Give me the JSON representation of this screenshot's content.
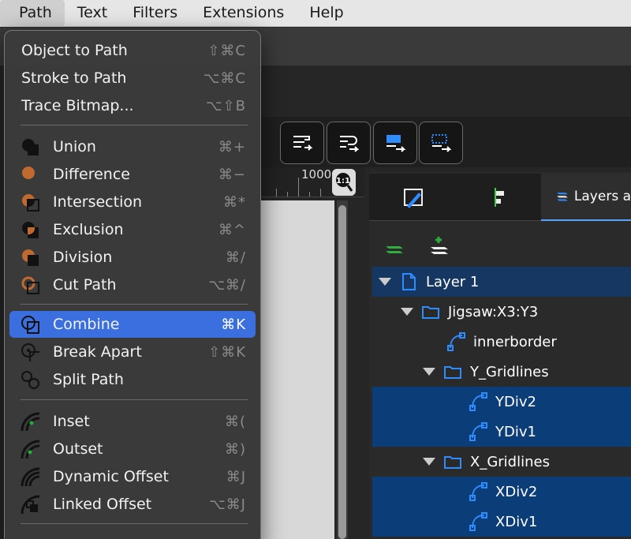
{
  "menubar": {
    "items": [
      {
        "label": "Path",
        "active": true
      },
      {
        "label": "Text",
        "active": false
      },
      {
        "label": "Filters",
        "active": false
      },
      {
        "label": "Extensions",
        "active": false
      },
      {
        "label": "Help",
        "active": false
      }
    ]
  },
  "path_menu": {
    "items": [
      {
        "label": "Object to Path",
        "shortcut": "⇧⌘C",
        "icon": "none"
      },
      {
        "label": "Stroke to Path",
        "shortcut": "⌥⌘C",
        "icon": "none"
      },
      {
        "label": "Trace Bitmap...",
        "shortcut": "⌥⇧B",
        "icon": "none"
      },
      {
        "label": "Union",
        "shortcut": "⌘+",
        "icon": "union-icon"
      },
      {
        "label": "Difference",
        "shortcut": "⌘−",
        "icon": "difference-icon"
      },
      {
        "label": "Intersection",
        "shortcut": "⌘*",
        "icon": "intersection-icon"
      },
      {
        "label": "Exclusion",
        "shortcut": "⌘^",
        "icon": "exclusion-icon"
      },
      {
        "label": "Division",
        "shortcut": "⌘/",
        "icon": "division-icon"
      },
      {
        "label": "Cut Path",
        "shortcut": "⌥⌘/",
        "icon": "cut-path-icon"
      },
      {
        "label": "Combine",
        "shortcut": "⌘K",
        "icon": "combine-icon",
        "highlighted": true
      },
      {
        "label": "Break Apart",
        "shortcut": "⇧⌘K",
        "icon": "break-apart-icon"
      },
      {
        "label": "Split Path",
        "shortcut": "",
        "icon": "split-path-icon"
      },
      {
        "label": "Inset",
        "shortcut": "⌘(",
        "icon": "inset-icon"
      },
      {
        "label": "Outset",
        "shortcut": "⌘)",
        "icon": "outset-icon"
      },
      {
        "label": "Dynamic Offset",
        "shortcut": "⌘J",
        "icon": "dynamic-offset-icon"
      },
      {
        "label": "Linked Offset",
        "shortcut": "⌥⌘J",
        "icon": "linked-offset-icon"
      }
    ]
  },
  "ruler": {
    "label": "1000"
  },
  "zoom": {
    "label": "1:1"
  },
  "dock": {
    "tabs": [
      {
        "label": "",
        "icon": "fill-stroke-icon"
      },
      {
        "label": "",
        "icon": "align-icon"
      },
      {
        "label": "Layers a",
        "icon": "layers-icon",
        "active": true
      }
    ]
  },
  "layers": {
    "rows": [
      {
        "label": "Layer 1",
        "type": "layer",
        "expanded": true,
        "state": "hl"
      },
      {
        "label": "Jigsaw:X3:Y3",
        "type": "group",
        "expanded": true,
        "state": "none"
      },
      {
        "label": "innerborder",
        "type": "path",
        "state": "none"
      },
      {
        "label": "Y_Gridlines",
        "type": "group",
        "expanded": true,
        "state": "none"
      },
      {
        "label": "YDiv2",
        "type": "path",
        "state": "sel"
      },
      {
        "label": "YDiv1",
        "type": "path",
        "state": "sel"
      },
      {
        "label": "X_Gridlines",
        "type": "group",
        "expanded": true,
        "state": "none"
      },
      {
        "label": "XDiv2",
        "type": "path",
        "state": "sel"
      },
      {
        "label": "XDiv1",
        "type": "path",
        "state": "sel"
      }
    ]
  },
  "colors": {
    "accent": "#3b6fe0",
    "selection": "#0b3d78",
    "icon_blue": "#2f8cff",
    "shape_orange": "#c06a30"
  }
}
